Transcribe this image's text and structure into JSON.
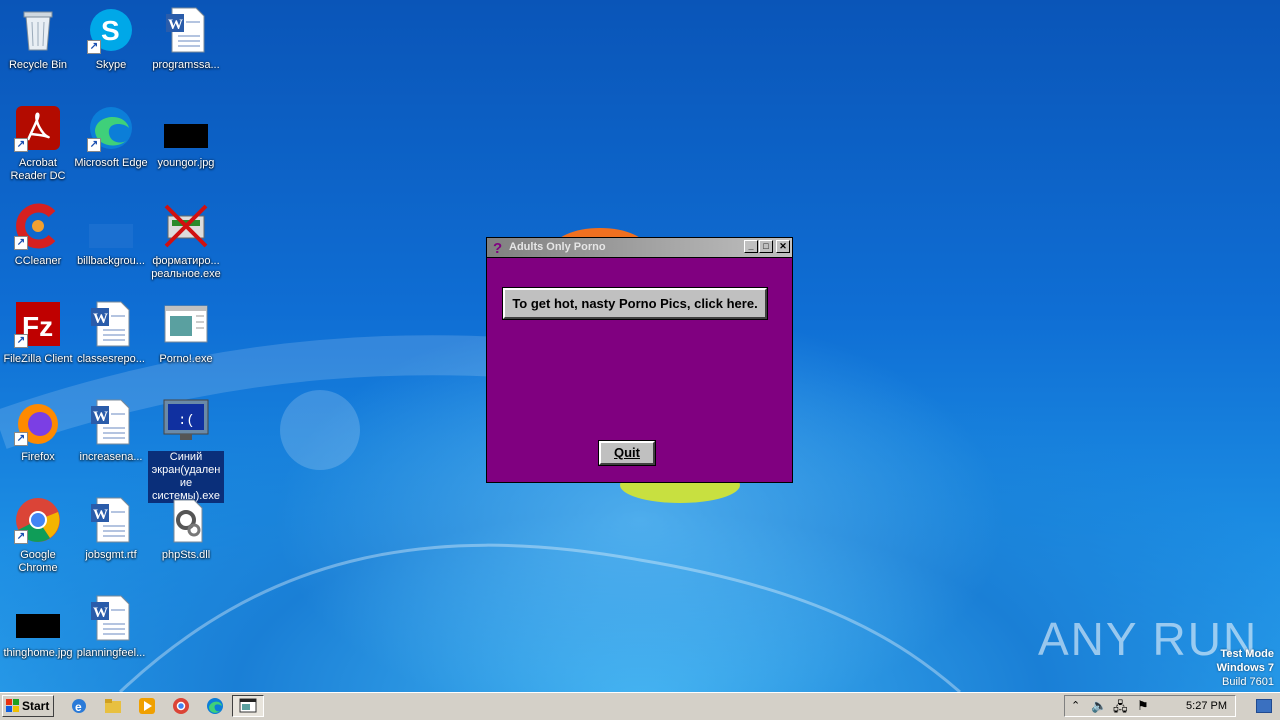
{
  "desktop": {
    "icons": [
      {
        "label": "Recycle Bin",
        "icon": "recycle-bin-icon"
      },
      {
        "label": "Skype",
        "icon": "skype-icon"
      },
      {
        "label": "programssa...",
        "icon": "word-doc-icon"
      },
      {
        "label": "Acrobat Reader DC",
        "icon": "acrobat-icon"
      },
      {
        "label": "Microsoft Edge",
        "icon": "edge-icon"
      },
      {
        "label": "youngor.jpg",
        "icon": "image-file-icon"
      },
      {
        "label": "CCleaner",
        "icon": "ccleaner-icon"
      },
      {
        "label": "billbackgrou...",
        "icon": "image-file-icon"
      },
      {
        "label": "форматиро... реальное.exe",
        "icon": "exe-icon"
      },
      {
        "label": "FileZilla Client",
        "icon": "filezilla-icon"
      },
      {
        "label": "classesrepo...",
        "icon": "word-doc-icon"
      },
      {
        "label": "Porno!.exe",
        "icon": "exe-window-icon"
      },
      {
        "label": "Firefox",
        "icon": "firefox-icon"
      },
      {
        "label": "increasena...",
        "icon": "word-doc-icon"
      },
      {
        "label": "Синий экран(удаление системы).exe",
        "icon": "bsod-exe-icon"
      },
      {
        "label": "Google Chrome",
        "icon": "chrome-icon"
      },
      {
        "label": "jobsgmt.rtf",
        "icon": "word-doc-icon"
      },
      {
        "label": "phpSts.dll",
        "icon": "dll-gear-icon"
      },
      {
        "label": "thinghome.jpg",
        "icon": "image-file-icon"
      },
      {
        "label": "planningfeel...",
        "icon": "word-doc-icon"
      }
    ]
  },
  "dialog": {
    "title": "Adults Only Porno",
    "main_button": "To get hot, nasty Porno Pics, click here.",
    "quit_button": "Quit",
    "background": "#800080"
  },
  "taskbar": {
    "start_label": "Start",
    "clock": "5:27 PM"
  },
  "os_watermark": {
    "line1": "Test Mode",
    "line2": "Windows 7",
    "line3": "Build 7601"
  },
  "brand_watermark": "ANY RUN"
}
